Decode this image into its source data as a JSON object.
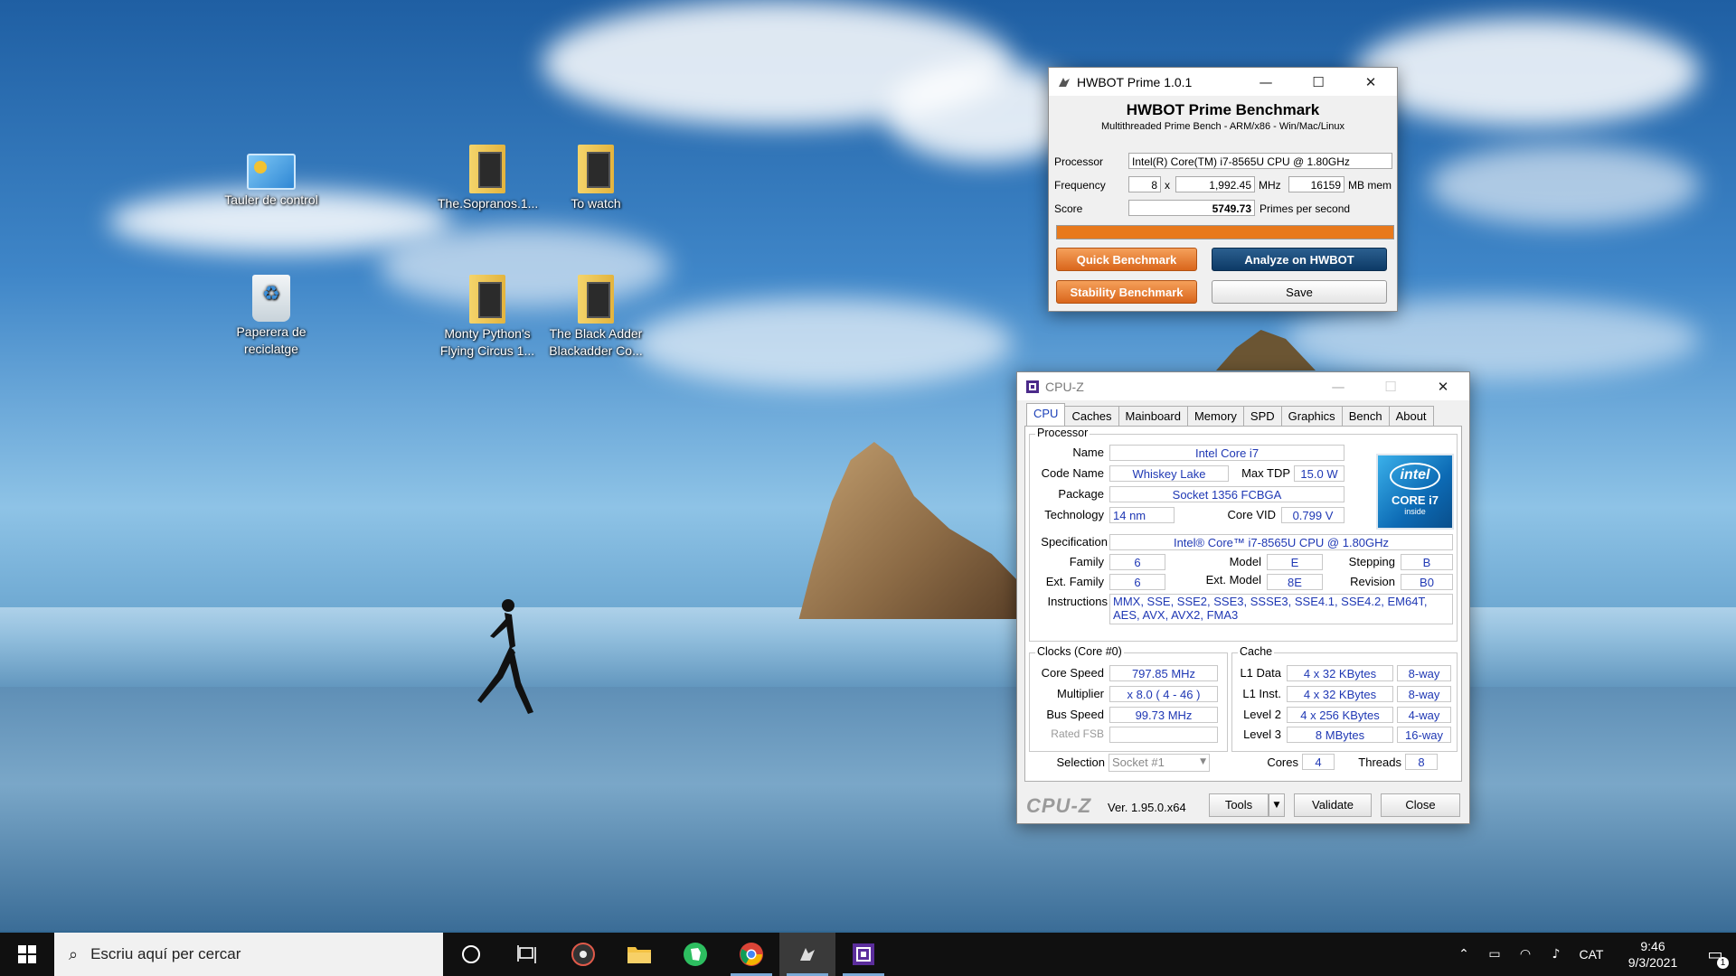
{
  "desktop": {
    "icons": [
      {
        "label": "Tauler de control"
      },
      {
        "label": "The.Sopranos.1..."
      },
      {
        "label": "To watch"
      },
      {
        "label": "Paperera de reciclatge"
      },
      {
        "label": "Monty Python's Flying Circus 1..."
      },
      {
        "label": "The Black Adder Blackadder Co..."
      }
    ]
  },
  "hwbot": {
    "title": "HWBOT Prime 1.0.1",
    "heading": "HWBOT Prime Benchmark",
    "subheading": "Multithreaded Prime Bench - ARM/x86 - Win/Mac/Linux",
    "processor_label": "Processor",
    "processor_value": "Intel(R) Core(TM) i7-8565U CPU @ 1.80GHz",
    "frequency_label": "Frequency",
    "threads_value": "8",
    "x_label": "x",
    "freq_value": "1,992.45",
    "mhz_label": "MHz",
    "mem_value": "16159",
    "mem_label": "MB mem",
    "score_label": "Score",
    "score_value": "5749.73",
    "score_unit": "Primes per second",
    "progress": 1.0,
    "quick_button": "Quick Benchmark",
    "analyze_button": "Analyze on HWBOT",
    "stability_button": "Stability Benchmark",
    "save_button": "Save"
  },
  "cpuz": {
    "title": "CPU-Z",
    "tabs": [
      "CPU",
      "Caches",
      "Mainboard",
      "Memory",
      "SPD",
      "Graphics",
      "Bench",
      "About"
    ],
    "active_tab": "CPU",
    "processor": {
      "group": "Processor",
      "name_label": "Name",
      "name": "Intel Core i7",
      "codename_label": "Code Name",
      "codename": "Whiskey Lake",
      "maxtdp_label": "Max TDP",
      "maxtdp": "15.0 W",
      "package_label": "Package",
      "package": "Socket 1356 FCBGA",
      "technology_label": "Technology",
      "technology": "14 nm",
      "corevid_label": "Core VID",
      "corevid": "0.799 V",
      "spec_label": "Specification",
      "spec": "Intel® Core™ i7-8565U CPU @ 1.80GHz",
      "family_label": "Family",
      "family": "6",
      "model_label": "Model",
      "model": "E",
      "stepping_label": "Stepping",
      "stepping": "B",
      "extfamily_label": "Ext. Family",
      "extfamily": "6",
      "extmodel_label": "Ext. Model",
      "extmodel": "8E",
      "revision_label": "Revision",
      "revision": "B0",
      "instructions_label": "Instructions",
      "instructions": "MMX, SSE, SSE2, SSE3, SSSE3, SSE4.1, SSE4.2, EM64T, AES, AVX, AVX2, FMA3"
    },
    "intel_logo": {
      "brand": "intel",
      "line": "CORE i7",
      "inside": "inside"
    },
    "clocks": {
      "group": "Clocks (Core #0)",
      "corespeed_label": "Core Speed",
      "corespeed": "797.85 MHz",
      "multiplier_label": "Multiplier",
      "multiplier": "x 8.0 ( 4 - 46 )",
      "busspeed_label": "Bus Speed",
      "busspeed": "99.73 MHz",
      "ratedfsb_label": "Rated FSB",
      "ratedfsb": ""
    },
    "cache": {
      "group": "Cache",
      "l1d_label": "L1 Data",
      "l1d": "4 x 32 KBytes",
      "l1d_way": "8-way",
      "l1i_label": "L1 Inst.",
      "l1i": "4 x 32 KBytes",
      "l1i_way": "8-way",
      "l2_label": "Level 2",
      "l2": "4 x 256 KBytes",
      "l2_way": "4-way",
      "l3_label": "Level 3",
      "l3": "8 MBytes",
      "l3_way": "16-way"
    },
    "selection_label": "Selection",
    "selection": "Socket #1",
    "cores_label": "Cores",
    "cores": "4",
    "threads_label": "Threads",
    "threads": "8",
    "logo": "CPU-Z",
    "version": "Ver. 1.95.0.x64",
    "tools_button": "Tools",
    "validate_button": "Validate",
    "close_button": "Close"
  },
  "taskbar": {
    "search_placeholder": "Escriu aquí per cercar",
    "language": "CAT",
    "time": "9:46",
    "date": "9/3/2021",
    "notification_count": "1"
  }
}
